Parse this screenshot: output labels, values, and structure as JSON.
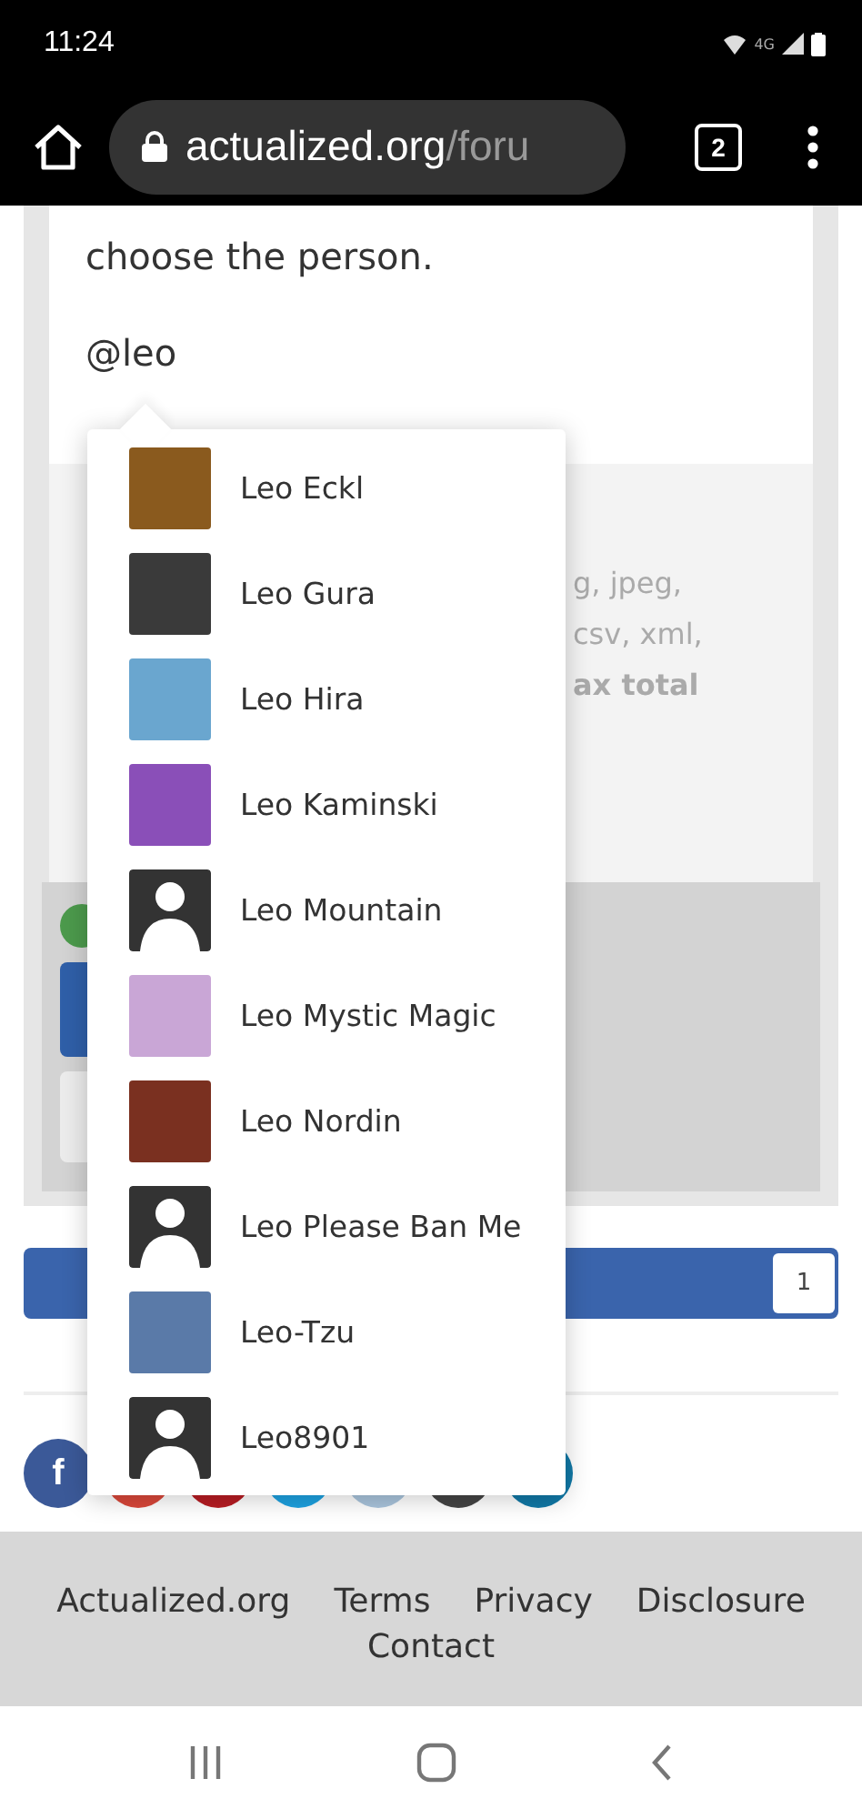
{
  "status_bar": {
    "time": "11:24",
    "network": "4G"
  },
  "browser": {
    "domain": "actualized.org",
    "path": "/foru",
    "tab_count": "2"
  },
  "editor": {
    "lines": [
      "choose the person.",
      "@leo"
    ]
  },
  "attachments": {
    "lines": [
      {
        "text": "g, jpeg,",
        "bold": false
      },
      {
        "text": "csv, xml,",
        "bold": false
      },
      {
        "text": "ax total",
        "bold": true
      }
    ]
  },
  "like_bar": {
    "count": "1"
  },
  "share_buttons": [
    {
      "color": "#3b5998",
      "label": "f"
    },
    {
      "color": "#d9473a"
    },
    {
      "color": "#b71c23"
    },
    {
      "color": "#1da1e0"
    },
    {
      "color": "#a9c4dc"
    },
    {
      "color": "#454545"
    },
    {
      "color": "#1178a6"
    }
  ],
  "mention_dropdown": [
    {
      "name": "Leo Eckl",
      "kind": "photo",
      "color": "#8a5a1e",
      "selected": false
    },
    {
      "name": "Leo Gura",
      "kind": "photo",
      "color": "#3a3a3a",
      "selected": false
    },
    {
      "name": "Leo Hira",
      "kind": "photo",
      "color": "#6aa6cf",
      "selected": false
    },
    {
      "name": "Leo Kaminski",
      "kind": "photo",
      "color": "#8a4fb8",
      "selected": false
    },
    {
      "name": "Leo Mountain",
      "kind": "default",
      "selected": false
    },
    {
      "name": "Leo Mystic Magic",
      "kind": "photo",
      "color": "#c9a6d6",
      "selected": false
    },
    {
      "name": "Leo Nordin",
      "kind": "photo",
      "color": "#7a3020",
      "selected": false
    },
    {
      "name": "Leo Please Ban Me",
      "kind": "default",
      "selected": false
    },
    {
      "name": "Leo-Tzu",
      "kind": "photo",
      "color": "#5a7aa8",
      "selected": false
    },
    {
      "name": "Leo8901",
      "kind": "default",
      "selected": false
    }
  ],
  "footer": {
    "links": [
      "Actualized.org",
      "Terms",
      "Privacy",
      "Disclosure",
      "Contact"
    ]
  }
}
